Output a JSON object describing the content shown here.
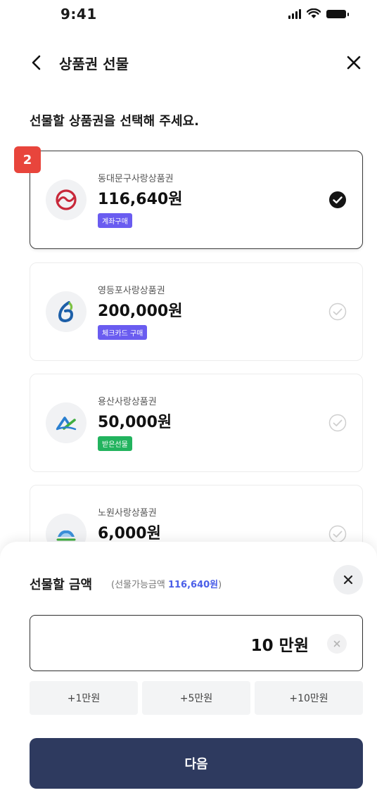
{
  "status_bar": {
    "time": "9:41"
  },
  "header": {
    "title": "상품권 선물"
  },
  "section_title": "선물할 상품권을 선택해 주세요.",
  "step_badge": "2",
  "cards": [
    {
      "name": "동대문구사랑상품권",
      "amount": "116,640원",
      "badge": "계좌구매",
      "badge_color": "#6a5cf0",
      "selected": true
    },
    {
      "name": "영등포사랑상품권",
      "amount": "200,000원",
      "badge": "체크카드 구매",
      "badge_color": "#6a5cf0",
      "selected": false
    },
    {
      "name": "용산사랑상품권",
      "amount": "50,000원",
      "badge": "받은선물",
      "badge_color": "#22b35e",
      "selected": false
    },
    {
      "name": "노원사랑상품권",
      "amount": "6,000원",
      "badge": "",
      "badge_color": "",
      "selected": false
    }
  ],
  "sheet": {
    "title": "선물할 금액",
    "sub_prefix": "(선물가능금액 ",
    "sub_amount": "116,640원",
    "sub_suffix": ")",
    "amount_value": "10 만원",
    "chips": [
      "+1만원",
      "+5만원",
      "+10만원"
    ],
    "next_label": "다음"
  },
  "icons": {
    "back": "chevron-left-icon",
    "close": "close-icon",
    "check_selected": "check-circle-filled-icon",
    "check_unselected": "check-circle-outline-icon",
    "clear": "clear-icon"
  },
  "colors": {
    "accent": "#4b5fe8",
    "primary_button": "#2e3a5f",
    "step_badge": "#e8453c",
    "badge_purple": "#6a5cf0",
    "badge_green": "#22b35e"
  }
}
